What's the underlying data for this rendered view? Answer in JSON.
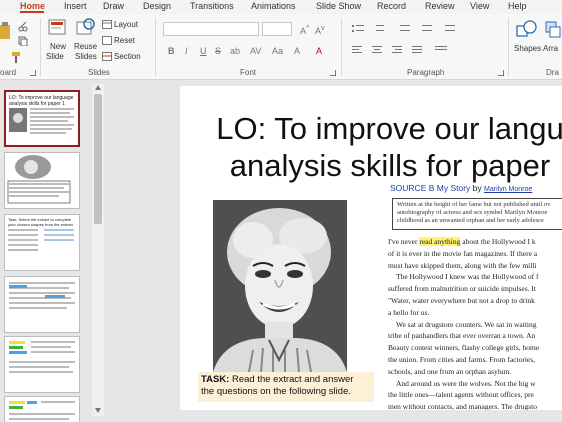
{
  "ribbon_tabs": [
    "Home",
    "Insert",
    "Draw",
    "Design",
    "Transitions",
    "Animations",
    "Slide Show",
    "Record",
    "Review",
    "View",
    "Help"
  ],
  "active_tab": "Home",
  "ribbon": {
    "clipboard": {
      "label": "oard"
    },
    "slides": {
      "new_slide": "New",
      "new_slide_2": "Slide",
      "reuse_slides": "Reuse",
      "reuse_slides_2": "Slides",
      "layout": "Layout",
      "reset": "Reset",
      "section": "Section",
      "label": "Slides"
    },
    "font": {
      "label": "Font",
      "buttons": [
        "B",
        "I",
        "U",
        "S",
        "ab",
        "AV",
        "Aa",
        "A",
        "A"
      ]
    },
    "paragraph": {
      "label": "Paragraph"
    },
    "shapes": {
      "label": "Shapes",
      "arrange_partial": "Arra",
      "drawing_label_partial": "Dra"
    }
  },
  "thumbnails": [
    {
      "number": "",
      "text": "LO: To improve our language analysis skills for paper 1",
      "selected": true
    },
    {
      "number": "",
      "text": "",
      "selected": false
    },
    {
      "number": "",
      "text": "Task: Select the extract to complete your chosen shapes from the extract",
      "selected": false
    },
    {
      "number": "",
      "text": "",
      "selected": false
    },
    {
      "number": "",
      "text": "",
      "selected": false
    },
    {
      "number": "",
      "text": "",
      "selected": false
    }
  ],
  "slide": {
    "title_line1": "LO: To improve our langu",
    "title_line2": "analysis skills for paper",
    "source_label": "SOURCE B My Story",
    "source_by": "by",
    "source_author": "Marilyn Monroe",
    "intro": [
      "Written at the height of her fame but not published until ov",
      "autobiography of actress and sex symbel Marilyn Monroe",
      "childhood as an unwanted orphan and her early adolesce"
    ],
    "body": [
      [
        "I've never ",
        "read anything",
        " about the Hollywood I k"
      ],
      [
        "of it is ever in the movie fan magazines. If there a",
        "",
        ""
      ],
      [
        "must have skipped them, along with the few milli",
        "",
        ""
      ],
      [
        "The Hollywood I knew was the Hollywood of f",
        "",
        ""
      ],
      [
        "suffered from malnutrition or suicide impulses. It",
        "",
        ""
      ],
      [
        "\"Water, water everywhere but not a drop to drink",
        "",
        ""
      ],
      [
        "a hello for us.",
        "",
        ""
      ],
      [
        "We sat at drugstore counters. We sat in waiting",
        "",
        ""
      ],
      [
        "tribe of panhandlers that ever overran a town. An",
        "",
        ""
      ],
      [
        "Beauty contest winners, flashy college girls, home",
        "",
        ""
      ],
      [
        "the union. From cities and farms. From factories,",
        "",
        ""
      ],
      [
        "schools, and one from an orphan asylum.",
        "",
        ""
      ],
      [
        "And around us were the wolves. Not the big w",
        "",
        ""
      ],
      [
        "the little ones—talent agents without offices, pre",
        "",
        ""
      ],
      [
        "men without contacts, and managers. The drugsto",
        "",
        ""
      ]
    ],
    "task_label": "TASK:",
    "task_text_1": " Read the extract and answer",
    "task_text_2": "the questions on the following slide."
  },
  "colors": {
    "accent": "#c43e1c",
    "selected_thumb": "#8b1f1f",
    "source_blue": "#1f3fa8",
    "task_bg": "#fdf0d6",
    "highlight": "#fff36b"
  }
}
